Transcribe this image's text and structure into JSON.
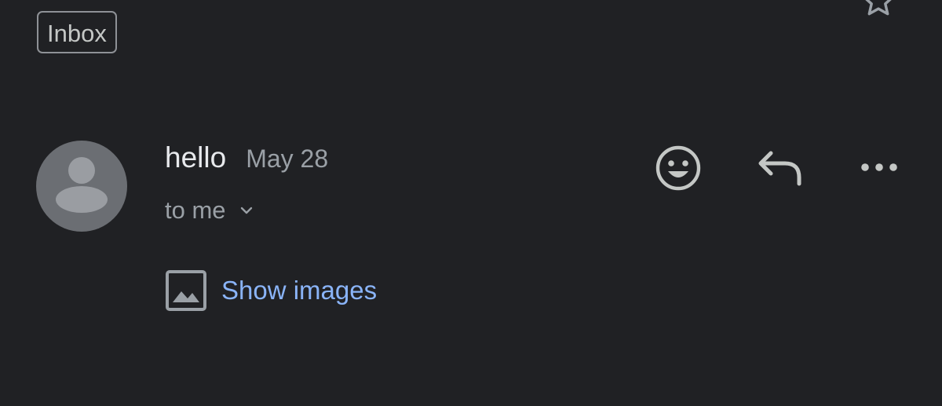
{
  "header": {
    "label_chip": "Inbox",
    "star_icon": "star-outline-icon"
  },
  "message": {
    "sender": "hello",
    "date": "May 28",
    "recipients": "to me",
    "avatar_icon": "person-icon",
    "actions": {
      "emoji_icon": "smiley-icon",
      "reply_icon": "reply-icon",
      "more_icon": "more-horizontal-icon"
    },
    "show_images": {
      "label": "Show images",
      "icon": "image-icon"
    }
  },
  "colors": {
    "background": "#202124",
    "primary_text": "#e8eaed",
    "secondary_text": "#9aa0a6",
    "link": "#8ab4f8",
    "avatar_bg": "#6b6e73",
    "icon": "#c4c7c5"
  }
}
